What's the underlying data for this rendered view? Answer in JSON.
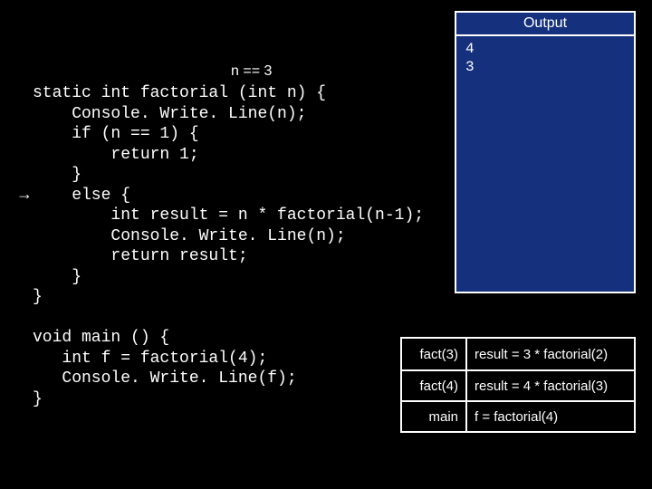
{
  "n_label": "n == 3",
  "arrow_glyph": "→",
  "code": {
    "factorial": "static int factorial (int n) {\n    Console. Write. Line(n);\n    if (n == 1) {\n        return 1;\n    }\n    else {\n        int result = n * factorial(n-1);\n        Console. Write. Line(n);\n        return result;\n    }\n}",
    "main": "void main () {\n   int f = factorial(4);\n   Console. Write. Line(f);\n}"
  },
  "output": {
    "title": "Output",
    "body": "4\n3"
  },
  "stack": [
    {
      "frame": "fact(3)",
      "state": "result = 3 * factorial(2)"
    },
    {
      "frame": "fact(4)",
      "state": "result = 4 * factorial(3)"
    },
    {
      "frame": "main",
      "state": "f = factorial(4)"
    }
  ]
}
